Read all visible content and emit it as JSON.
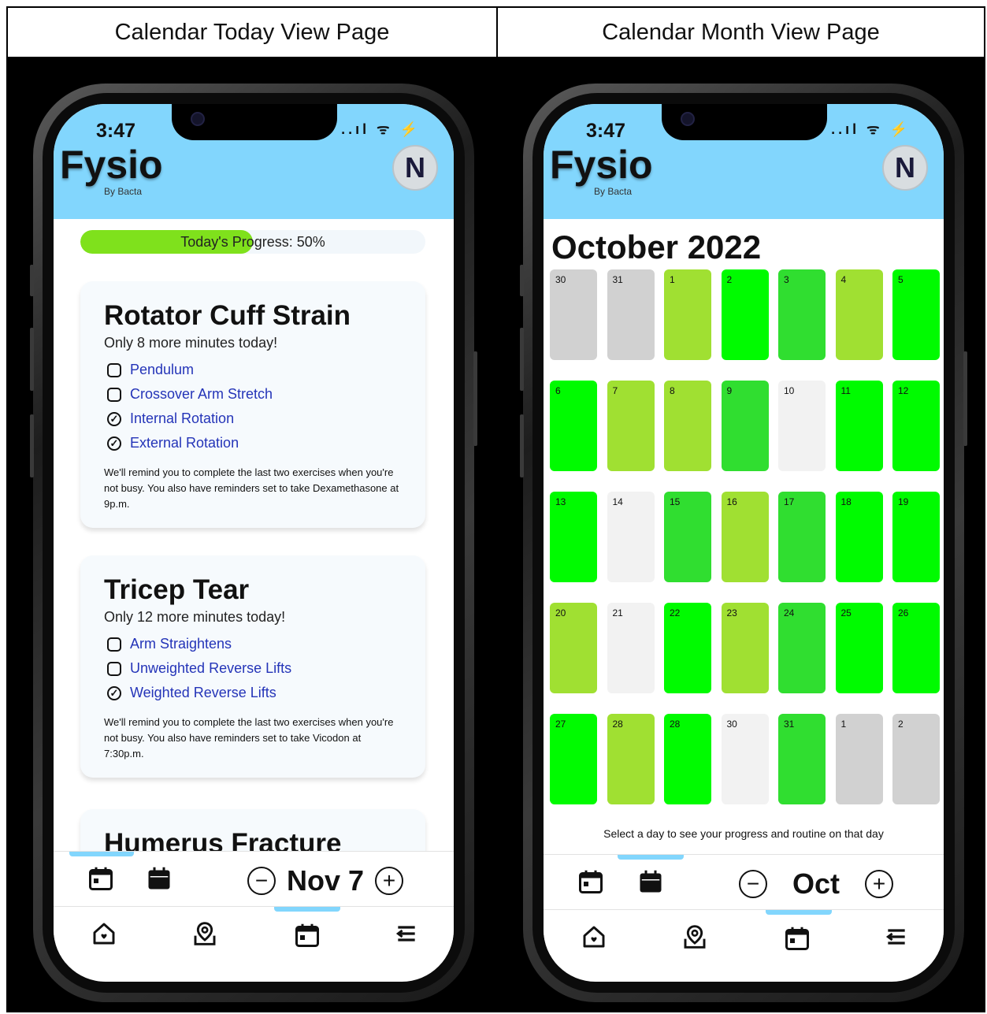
{
  "headers": {
    "left": "Calendar Today View Page",
    "right": "Calendar Month View Page"
  },
  "app": {
    "time": "3:47",
    "status_icons": "..ıl ᯤ ⚡",
    "brand": "Fysio",
    "brand_sub": "By Bacta",
    "avatar": "N",
    "colors": {
      "accent": "#82d6fd",
      "progress": "#7fe11c",
      "link": "#2434b8"
    }
  },
  "today": {
    "progress_label": "Today's Progress: 50%",
    "progress_value": 50,
    "cards": [
      {
        "title": "Rotator Cuff Strain",
        "subtitle": "Only 8 more minutes today!",
        "exercises": [
          {
            "label": "Pendulum",
            "done": false
          },
          {
            "label": "Crossover Arm Stretch",
            "done": false
          },
          {
            "label": "Internal Rotation",
            "done": true
          },
          {
            "label": "External Rotation",
            "done": true
          }
        ],
        "note": "We'll remind you to complete the last two exercises when you're not busy. You also have reminders set to take Dexamethasone at 9p.m."
      },
      {
        "title": "Tricep Tear",
        "subtitle": "Only 12 more minutes today!",
        "exercises": [
          {
            "label": "Arm Straightens",
            "done": false
          },
          {
            "label": "Unweighted Reverse Lifts",
            "done": false
          },
          {
            "label": "Weighted Reverse Lifts",
            "done": true
          }
        ],
        "note": "We'll remind you to complete the last two exercises when you're not busy. You also have reminders set to take Vicodon at 7:30p.m."
      },
      {
        "title": "Humerus Fracture"
      }
    ],
    "date_label": "Nov 7"
  },
  "month": {
    "title": "October 2022",
    "hint": "Select a day to see your progress and routine on that day",
    "date_label": "Oct",
    "status_colors": {
      "other": "#d1d1d1",
      "none": "#f2f2f2",
      "partial": "#a0e032",
      "good": "#30de30",
      "full": "#00fb00"
    },
    "days": [
      {
        "n": "30",
        "s": "other"
      },
      {
        "n": "31",
        "s": "other"
      },
      {
        "n": "1",
        "s": "partial"
      },
      {
        "n": "2",
        "s": "full"
      },
      {
        "n": "3",
        "s": "good"
      },
      {
        "n": "4",
        "s": "partial"
      },
      {
        "n": "5",
        "s": "full"
      },
      {
        "n": "6",
        "s": "full"
      },
      {
        "n": "7",
        "s": "partial"
      },
      {
        "n": "8",
        "s": "partial"
      },
      {
        "n": "9",
        "s": "good"
      },
      {
        "n": "10",
        "s": "none"
      },
      {
        "n": "11",
        "s": "full"
      },
      {
        "n": "12",
        "s": "full"
      },
      {
        "n": "13",
        "s": "full"
      },
      {
        "n": "14",
        "s": "none"
      },
      {
        "n": "15",
        "s": "good"
      },
      {
        "n": "16",
        "s": "partial"
      },
      {
        "n": "17",
        "s": "good"
      },
      {
        "n": "18",
        "s": "full"
      },
      {
        "n": "19",
        "s": "full"
      },
      {
        "n": "20",
        "s": "partial"
      },
      {
        "n": "21",
        "s": "none"
      },
      {
        "n": "22",
        "s": "full"
      },
      {
        "n": "23",
        "s": "partial"
      },
      {
        "n": "24",
        "s": "good"
      },
      {
        "n": "25",
        "s": "full"
      },
      {
        "n": "26",
        "s": "full"
      },
      {
        "n": "27",
        "s": "full"
      },
      {
        "n": "28",
        "s": "partial"
      },
      {
        "n": "28",
        "s": "full"
      },
      {
        "n": "30",
        "s": "none"
      },
      {
        "n": "31",
        "s": "good"
      },
      {
        "n": "1",
        "s": "other"
      },
      {
        "n": "2",
        "s": "other"
      }
    ]
  },
  "icons": {
    "day_view": "calendar-day-icon",
    "month_view": "calendar-month-icon",
    "minus": "−",
    "plus": "+",
    "home": "home-icon",
    "map": "map-pin-icon",
    "calendar": "calendar-icon",
    "menu": "menu-icon"
  }
}
